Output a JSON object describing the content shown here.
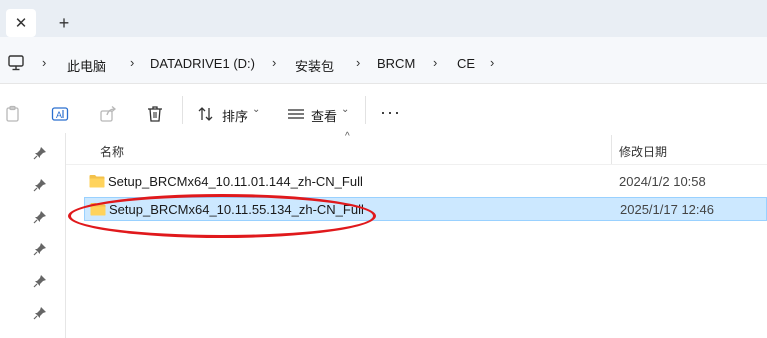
{
  "tabs": {
    "close_glyph": "✕",
    "add_glyph": "+"
  },
  "breadcrumb": {
    "items": [
      "此电脑",
      "DATADRIVE1 (D:)",
      "安装包",
      "BRCM",
      "CE"
    ],
    "separator": "›"
  },
  "toolbar": {
    "sort_label": "排序",
    "view_label": "查看",
    "more_label": "···",
    "caret": "⌄"
  },
  "columns": {
    "name": "名称",
    "date_modified": "修改日期",
    "sort_indicator": "^"
  },
  "files": [
    {
      "name": "Setup_BRCMx64_10.11.01.144_zh-CN_Full",
      "date": "2024/1/2 10:58",
      "type": "folder",
      "selected": false
    },
    {
      "name": "Setup_BRCMx64_10.11.55.134_zh-CN_Full",
      "date": "2025/1/17 12:46",
      "type": "folder",
      "selected": true
    }
  ],
  "colors": {
    "selection_fill": "#cce8ff",
    "selection_border": "#99d1ff",
    "annotation": "#e0191c",
    "folder": "#f3c14b"
  }
}
